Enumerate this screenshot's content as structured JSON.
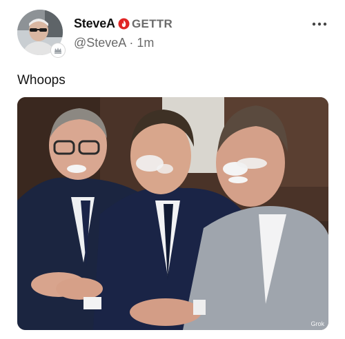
{
  "post": {
    "display_name": "SteveA",
    "brand": "GETTR",
    "handle": "@SteveA",
    "separator": "·",
    "time": "1m",
    "text": "Whoops",
    "more_icon": "more-horizontal-icon",
    "verified_icon": "verified-flame-icon",
    "image_watermark": "Grok"
  },
  "colors": {
    "accent": "#e02424",
    "text_primary": "#111111",
    "text_secondary": "#6a6a6a"
  }
}
